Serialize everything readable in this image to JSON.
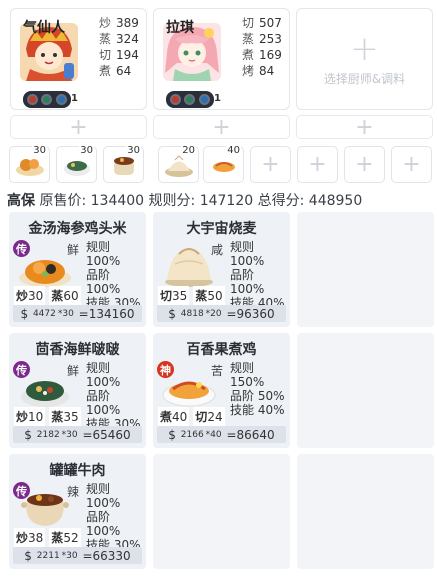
{
  "chefs": [
    {
      "name": "气仙人",
      "stats": [
        {
          "k": "炒",
          "v": "389"
        },
        {
          "k": "蒸",
          "v": "324"
        },
        {
          "k": "切",
          "v": "194"
        },
        {
          "k": "煮",
          "v": "64"
        }
      ],
      "level": "1"
    },
    {
      "name": "拉琪",
      "stats": [
        {
          "k": "切",
          "v": "507"
        },
        {
          "k": "蒸",
          "v": "253"
        },
        {
          "k": "煮",
          "v": "169"
        },
        {
          "k": "烤",
          "v": "84"
        }
      ],
      "level": "1"
    }
  ],
  "empty_chef_label": "选择厨师&调料",
  "materials": [
    {
      "count": "30"
    },
    {
      "count": "30"
    },
    {
      "count": "30"
    },
    {
      "count": "20"
    },
    {
      "count": "40"
    }
  ],
  "summary": {
    "label": "高保",
    "original_price_label": "原售价:",
    "original_price": "134400",
    "rule_score_label": "规则分:",
    "rule_score": "147120",
    "total_label": "总得分:",
    "total": "448950"
  },
  "dishes": [
    {
      "name": "金汤海参鸡头米",
      "rarity": "传",
      "flavor": "鲜",
      "rule": "规则 100%",
      "grade": "品阶 100%",
      "skill": "技能 30%",
      "skills": [
        {
          "k": "炒",
          "v": "30"
        },
        {
          "k": "蒸",
          "v": "60"
        }
      ],
      "price": "4472",
      "mult": "*30",
      "total": "134160"
    },
    {
      "name": "大宇宙烧麦",
      "rarity": "",
      "flavor": "咸",
      "rule": "规则 100%",
      "grade": "品阶 100%",
      "skill": "技能 40%",
      "skills": [
        {
          "k": "切",
          "v": "35"
        },
        {
          "k": "蒸",
          "v": "50"
        }
      ],
      "price": "4818",
      "mult": "*20",
      "total": "96360"
    },
    {
      "name": "茴香海鲜啵啵",
      "rarity": "传",
      "flavor": "鲜",
      "rule": "规则 100%",
      "grade": "品阶 100%",
      "skill": "技能 30%",
      "skills": [
        {
          "k": "炒",
          "v": "10"
        },
        {
          "k": "蒸",
          "v": "35"
        }
      ],
      "price": "2182",
      "mult": "*30",
      "total": "65460"
    },
    {
      "name": "百香果煮鸡",
      "rarity": "神",
      "flavor": "苦",
      "rule": "规则 150%",
      "grade": "品阶 50%",
      "skill": "技能 40%",
      "skills": [
        {
          "k": "煮",
          "v": "40"
        },
        {
          "k": "切",
          "v": "24"
        }
      ],
      "price": "2166",
      "mult": "*40",
      "total": "86640"
    },
    {
      "name": "罐罐牛肉",
      "rarity": "传",
      "flavor": "辣",
      "rule": "规则 100%",
      "grade": "品阶 100%",
      "skill": "技能 30%",
      "skills": [
        {
          "k": "炒",
          "v": "38"
        },
        {
          "k": "蒸",
          "v": "52"
        }
      ],
      "price": "2211",
      "mult": "*30",
      "total": "66330"
    }
  ],
  "currency": "$",
  "eq": "="
}
